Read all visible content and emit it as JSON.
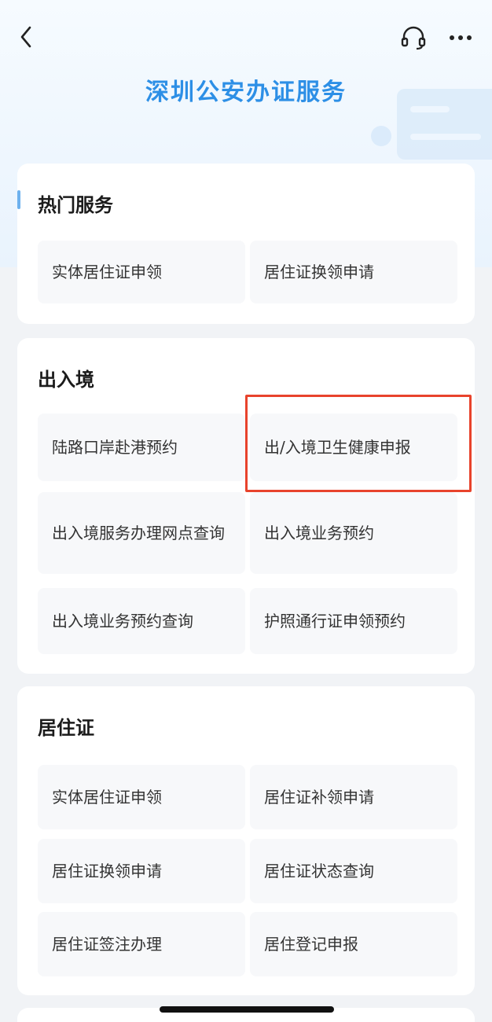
{
  "header": {
    "title": "深圳公安办证服务"
  },
  "sections": [
    {
      "title": "热门服务",
      "items": [
        "实体居住证申领",
        "居住证换领申请"
      ]
    },
    {
      "title": "出入境",
      "items": [
        "陆路口岸赴港预约",
        "出/入境卫生健康申报",
        "出入境服务办理网点查询",
        "出入境业务预约",
        "出入境业务预约查询",
        "护照通行证申领预约"
      ]
    },
    {
      "title": "居住证",
      "items": [
        "实体居住证申领",
        "居住证补领申请",
        "居住证换领申请",
        "居住证状态查询",
        "居住证签注办理",
        "居住登记申报"
      ]
    }
  ],
  "icons": {
    "back": "back-icon",
    "service": "headset-icon",
    "more": "more-icon"
  },
  "colors": {
    "title": "#2d8fe6",
    "highlight": "#e8432c"
  }
}
